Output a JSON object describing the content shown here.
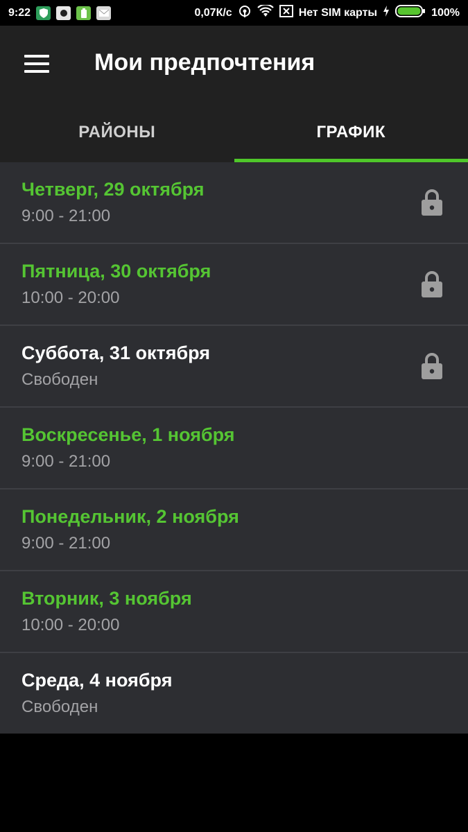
{
  "status_bar": {
    "time": "9:22",
    "network_speed": "0,07К/с",
    "sim_status": "Нет SIM карты",
    "battery": "100%",
    "icons": [
      "shield-icon",
      "record-icon",
      "battery-notif-icon",
      "mail-icon",
      "hotspot-icon",
      "wifi-icon",
      "no-sim-icon",
      "charging-icon",
      "battery-icon"
    ]
  },
  "app_bar": {
    "title": "Мои предпочтения",
    "menu_icon": "hamburger-menu-icon"
  },
  "tabs": [
    {
      "label": "РАЙОНЫ",
      "active": false
    },
    {
      "label": "ГРАФИК",
      "active": true
    }
  ],
  "colors": {
    "accent_green": "#55c533",
    "app_bar_bg": "#212121",
    "list_bg": "#2d2e32"
  },
  "schedule": [
    {
      "day": "Четверг, 29 октября",
      "hours": "9:00 - 21:00",
      "state": "assigned",
      "locked": true
    },
    {
      "day": "Пятница, 30 октября",
      "hours": "10:00 - 20:00",
      "state": "assigned",
      "locked": true
    },
    {
      "day": "Суббота, 31 октября",
      "hours": "Свободен",
      "state": "free",
      "locked": true
    },
    {
      "day": "Воскресенье, 1 ноября",
      "hours": "9:00 - 21:00",
      "state": "assigned",
      "locked": false
    },
    {
      "day": "Понедельник, 2 ноября",
      "hours": "9:00 - 21:00",
      "state": "assigned",
      "locked": false
    },
    {
      "day": "Вторник, 3 ноября",
      "hours": "10:00 - 20:00",
      "state": "assigned",
      "locked": false
    },
    {
      "day": "Среда, 4 ноября",
      "hours": "Свободен",
      "state": "free",
      "locked": false
    }
  ]
}
